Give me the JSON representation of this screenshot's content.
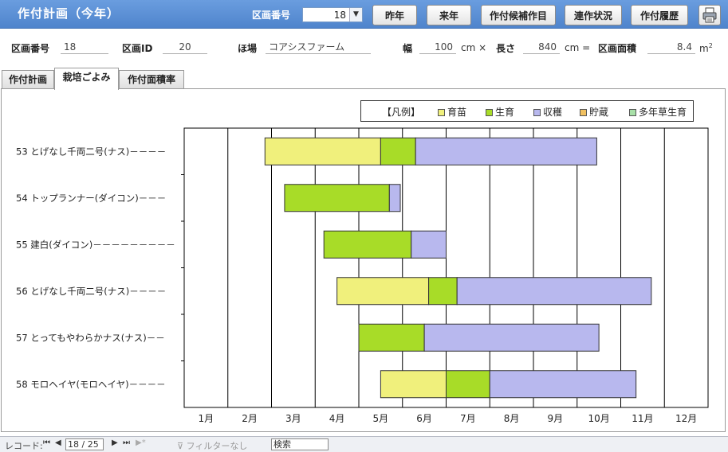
{
  "header": {
    "title": "作付計画（今年）",
    "plot_label": "区画番号",
    "plot_value": "18",
    "buttons": {
      "prev_year": "昨年",
      "next_year": "来年",
      "candidates": "作付候補作目",
      "rotation": "連作状況",
      "history": "作付履歴"
    }
  },
  "info": {
    "plot_no_label": "区画番号",
    "plot_no_value": "18",
    "plot_id_label": "区画ID",
    "plot_id_value": "20",
    "field_label": "ほ場",
    "field_value": "コアシスファーム",
    "width_label": "幅",
    "width_value": "100",
    "width_unit": "cm ×",
    "length_label": "長さ",
    "length_value": "840",
    "length_unit": "cm =",
    "area_label": "区画面積",
    "area_value": "8.4",
    "area_unit": "m",
    "area_unit_sup": "2"
  },
  "tabs": [
    {
      "label": "作付計画",
      "active": false
    },
    {
      "label": "栽培ごよみ",
      "active": true
    },
    {
      "label": "作付面積率",
      "active": false
    }
  ],
  "legend": {
    "title": "【凡例】",
    "items": [
      {
        "label": "育苗",
        "color": "#f0f07c"
      },
      {
        "label": "生育",
        "color": "#a8dc28"
      },
      {
        "label": "収穫",
        "color": "#b8b8ee"
      },
      {
        "label": "貯蔵",
        "color": "#f0c060"
      },
      {
        "label": "多年草生育",
        "color": "#a8e0a8"
      }
    ]
  },
  "chart_data": {
    "type": "bar",
    "subtype": "gantt",
    "x_unit": "month",
    "xlim": [
      1,
      13
    ],
    "month_labels": [
      "1月",
      "2月",
      "3月",
      "4月",
      "5月",
      "6月",
      "7月",
      "8月",
      "9月",
      "10月",
      "11月",
      "12月"
    ],
    "phase_colors": {
      "育苗": "#f0f07c",
      "生育": "#a8dc28",
      "収穫": "#b8b8ee"
    },
    "rows": [
      {
        "label": "53 とげなし千両二号(ナス)－－－－",
        "segments": [
          {
            "phase": "育苗",
            "start": 2.85,
            "end": 5.5
          },
          {
            "phase": "生育",
            "start": 5.5,
            "end": 6.3
          },
          {
            "phase": "収穫",
            "start": 6.3,
            "end": 10.45
          }
        ]
      },
      {
        "label": "54 トップランナー(ダイコン)－－－",
        "segments": [
          {
            "phase": "生育",
            "start": 3.3,
            "end": 5.7
          },
          {
            "phase": "収穫",
            "start": 5.7,
            "end": 5.95
          }
        ]
      },
      {
        "label": "55 建白(ダイコン)－－－－－－－－－",
        "segments": [
          {
            "phase": "生育",
            "start": 4.2,
            "end": 6.2
          },
          {
            "phase": "収穫",
            "start": 6.2,
            "end": 7.0
          }
        ]
      },
      {
        "label": "56 とげなし千両二号(ナス)－－－－",
        "segments": [
          {
            "phase": "育苗",
            "start": 4.5,
            "end": 6.6
          },
          {
            "phase": "生育",
            "start": 6.6,
            "end": 7.25
          },
          {
            "phase": "収穫",
            "start": 7.25,
            "end": 11.7
          }
        ]
      },
      {
        "label": "57 とってもやわらかナス(ナス)－－",
        "segments": [
          {
            "phase": "生育",
            "start": 5.0,
            "end": 6.5
          },
          {
            "phase": "収穫",
            "start": 6.5,
            "end": 10.5
          }
        ]
      },
      {
        "label": "58 モロヘイヤ(モロヘイヤ)－－－－",
        "segments": [
          {
            "phase": "育苗",
            "start": 5.5,
            "end": 7.0
          },
          {
            "phase": "生育",
            "start": 7.0,
            "end": 8.0
          },
          {
            "phase": "収穫",
            "start": 8.0,
            "end": 11.35
          }
        ]
      }
    ]
  },
  "status": {
    "record_label": "レコード:",
    "record_value": "18 / 25",
    "filter_label": "フィルターなし",
    "search_label": "検索"
  }
}
